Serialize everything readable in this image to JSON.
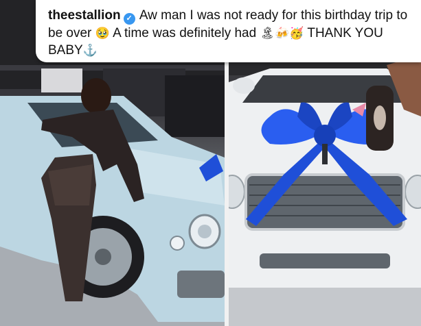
{
  "caption": {
    "username": "theestallion",
    "verified_icon": "verified-badge-icon",
    "text_part1": "Aw man I was not ready for this birthday trip to be over",
    "emoji_1": "🥹",
    "text_part2": "A time was definitely had",
    "emoji_2": "🏝",
    "emoji_3": "🍻",
    "emoji_4": "🥳",
    "text_part3": "THANK YOU BABY",
    "emoji_5": "⚓"
  },
  "colors": {
    "left_car": "#bcd6e2",
    "right_car": "#eef0f2",
    "bow": "#1f4fd8",
    "verified": "#3897f0"
  },
  "photos": [
    {
      "name": "left-photo",
      "subject": "woman-leaning-on-light-blue-car"
    },
    {
      "name": "right-photo",
      "subject": "white-car-with-blue-bow-and-key"
    }
  ]
}
